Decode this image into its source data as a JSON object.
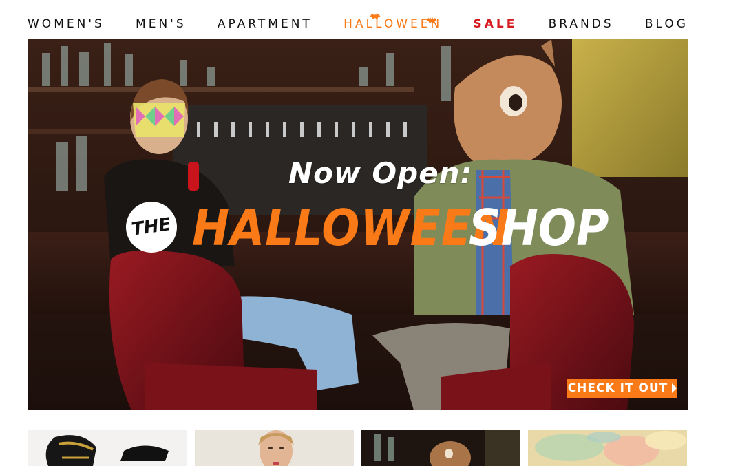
{
  "nav": {
    "items": [
      {
        "label": "WOMEN'S"
      },
      {
        "label": "MEN'S"
      },
      {
        "label": "APARTMENT"
      },
      {
        "label": "HALLOWEEN"
      },
      {
        "label": "SALE"
      },
      {
        "label": "BRANDS"
      },
      {
        "label": "BLOG"
      }
    ],
    "icons": [
      "bat-icon"
    ]
  },
  "hero": {
    "now_open": "Now Open:",
    "the": "THE",
    "halloween": "HALLOWEEN",
    "shop": "SHOP",
    "cta_label": "CHECK IT OUT"
  },
  "colors": {
    "accent_orange": "#f97a17",
    "sale_red": "#d71a20",
    "nav_text": "#111111"
  },
  "thumbnails": [
    {
      "subject": "black shoes with gold chains"
    },
    {
      "subject": "model portrait"
    },
    {
      "subject": "squirrel mask in bar"
    },
    {
      "subject": "pastel floral texture"
    }
  ]
}
